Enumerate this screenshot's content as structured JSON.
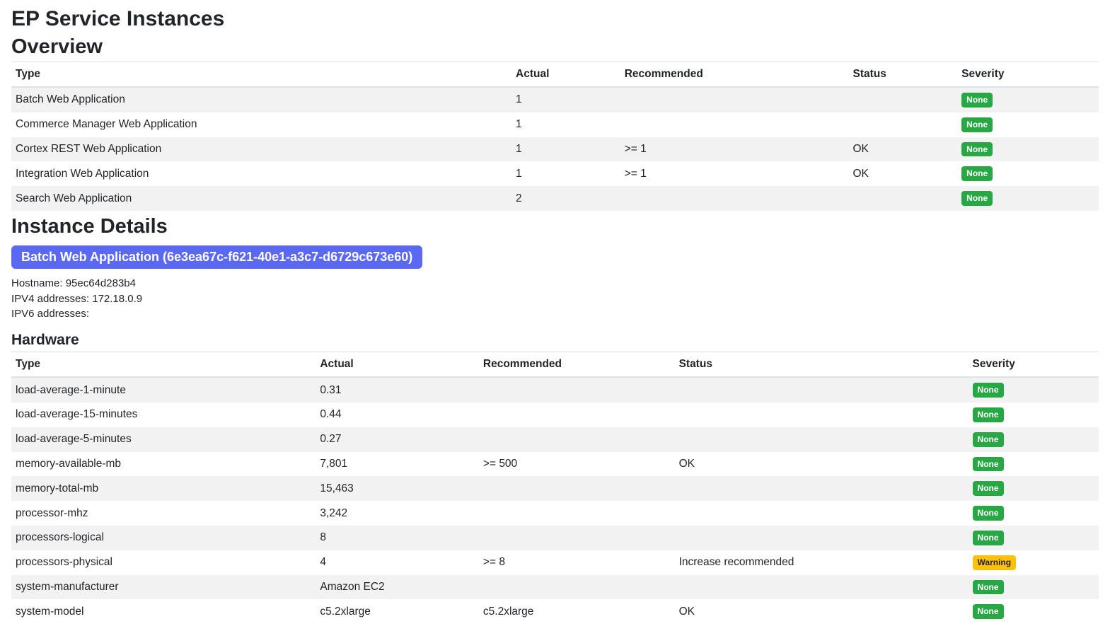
{
  "page": {
    "title": "EP Service Instances",
    "overview_heading": "Overview",
    "instance_details_heading": "Instance Details",
    "hardware_heading": "Hardware"
  },
  "columns": {
    "type": "Type",
    "actual": "Actual",
    "recommended": "Recommended",
    "status": "Status",
    "severity": "Severity"
  },
  "overview": {
    "rows": [
      {
        "type": "Batch Web Application",
        "actual": "1",
        "recommended": "",
        "status": "",
        "severity": "None",
        "severity_class": "badge-none"
      },
      {
        "type": "Commerce Manager Web Application",
        "actual": "1",
        "recommended": "",
        "status": "",
        "severity": "None",
        "severity_class": "badge-none"
      },
      {
        "type": "Cortex REST Web Application",
        "actual": "1",
        "recommended": ">= 1",
        "status": "OK",
        "severity": "None",
        "severity_class": "badge-none"
      },
      {
        "type": "Integration Web Application",
        "actual": "1",
        "recommended": ">= 1",
        "status": "OK",
        "severity": "None",
        "severity_class": "badge-none"
      },
      {
        "type": "Search Web Application",
        "actual": "2",
        "recommended": "",
        "status": "",
        "severity": "None",
        "severity_class": "badge-none"
      }
    ]
  },
  "instance": {
    "pill": "Batch Web Application (6e3ea67c-f621-40e1-a3c7-d6729c673e60)",
    "hostname_label": "Hostname:",
    "hostname_value": "95ec64d283b4",
    "ipv4_label": "IPV4 addresses:",
    "ipv4_value": "172.18.0.9",
    "ipv6_label": "IPV6 addresses:",
    "ipv6_value": ""
  },
  "hardware": {
    "rows": [
      {
        "type": "load-average-1-minute",
        "actual": "0.31",
        "recommended": "",
        "status": "",
        "severity": "None",
        "severity_class": "badge-none"
      },
      {
        "type": "load-average-15-minutes",
        "actual": "0.44",
        "recommended": "",
        "status": "",
        "severity": "None",
        "severity_class": "badge-none"
      },
      {
        "type": "load-average-5-minutes",
        "actual": "0.27",
        "recommended": "",
        "status": "",
        "severity": "None",
        "severity_class": "badge-none"
      },
      {
        "type": "memory-available-mb",
        "actual": "7,801",
        "recommended": ">= 500",
        "status": "OK",
        "severity": "None",
        "severity_class": "badge-none"
      },
      {
        "type": "memory-total-mb",
        "actual": "15,463",
        "recommended": "",
        "status": "",
        "severity": "None",
        "severity_class": "badge-none"
      },
      {
        "type": "processor-mhz",
        "actual": "3,242",
        "recommended": "",
        "status": "",
        "severity": "None",
        "severity_class": "badge-none"
      },
      {
        "type": "processors-logical",
        "actual": "8",
        "recommended": "",
        "status": "",
        "severity": "None",
        "severity_class": "badge-none"
      },
      {
        "type": "processors-physical",
        "actual": "4",
        "recommended": ">= 8",
        "status": "Increase recommended",
        "severity": "Warning",
        "severity_class": "badge-warning"
      },
      {
        "type": "system-manufacturer",
        "actual": "Amazon EC2",
        "recommended": "",
        "status": "",
        "severity": "None",
        "severity_class": "badge-none"
      },
      {
        "type": "system-model",
        "actual": "c5.2xlarge",
        "recommended": "c5.2xlarge",
        "status": "OK",
        "severity": "None",
        "severity_class": "badge-none"
      }
    ]
  }
}
